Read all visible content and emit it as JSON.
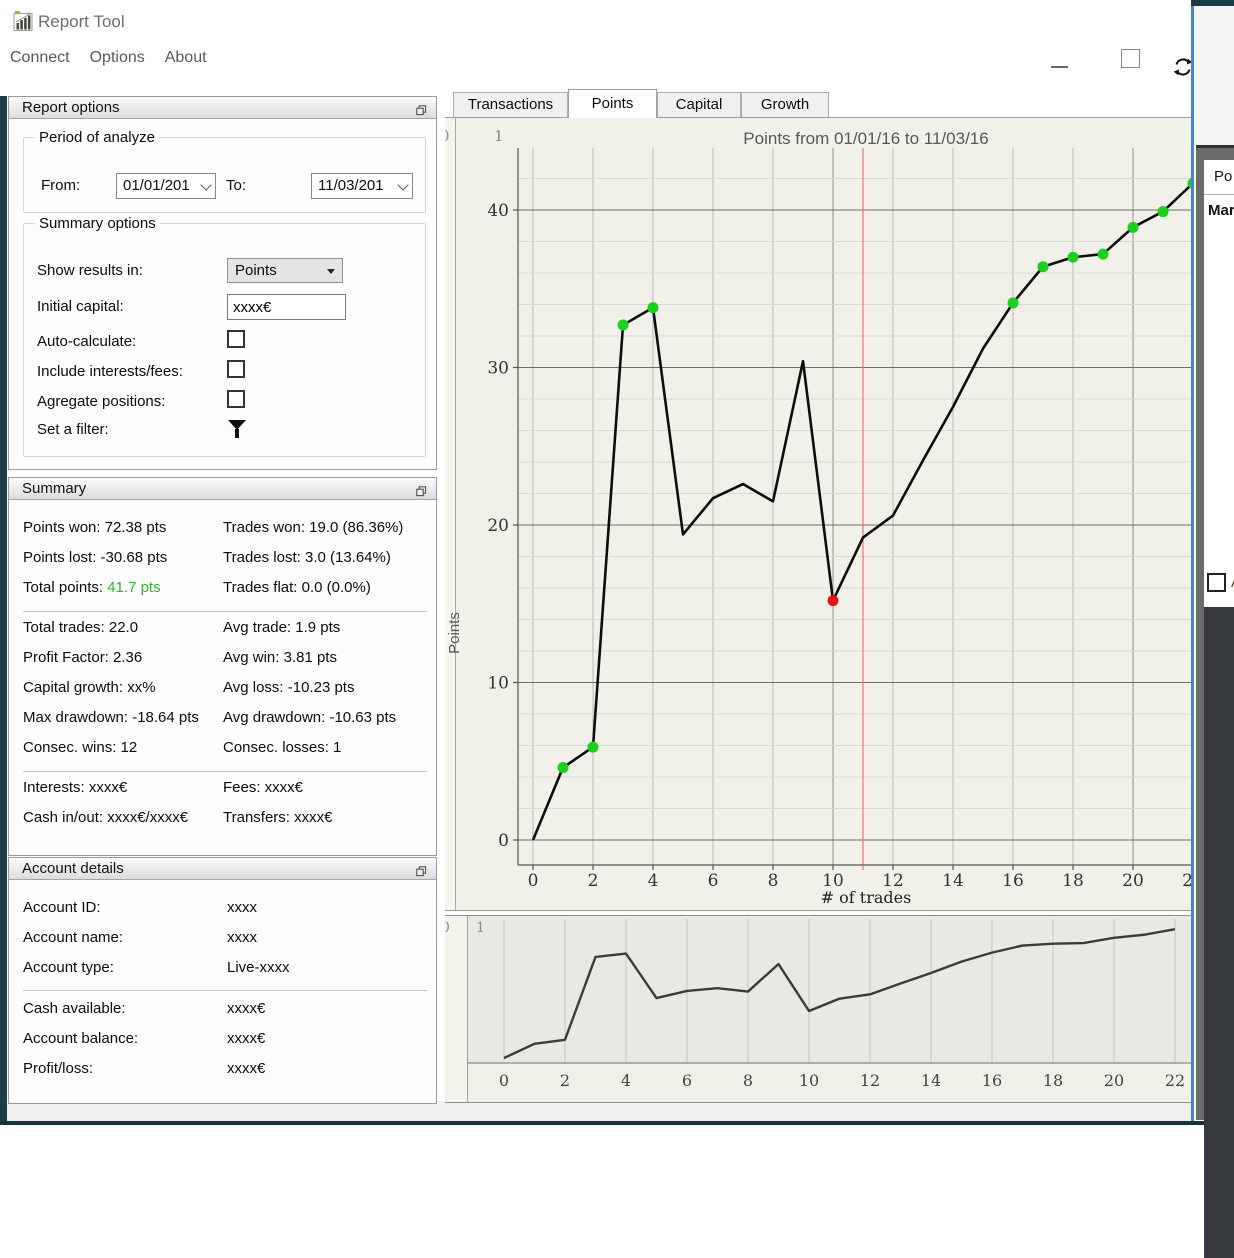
{
  "titlebar": {
    "title": "Report Tool",
    "menu": [
      "Connect",
      "Options",
      "About"
    ]
  },
  "panels": {
    "report_options": {
      "header": "Report options",
      "period_group": {
        "legend": "Period of analyze",
        "from_label": "From:",
        "from_value": "01/01/201",
        "to_label": "To:",
        "to_value": "11/03/201"
      },
      "summary_group": {
        "legend": "Summary options",
        "show_results_label": "Show results in:",
        "show_results_value": "Points",
        "initial_capital_label": "Initial capital:",
        "initial_capital_value": "xxxx€",
        "auto_calculate_label": "Auto-calculate:",
        "include_fees_label": "Include interests/fees:",
        "agregate_label": "Agregate positions:",
        "filter_label": "Set a filter:"
      }
    },
    "summary": {
      "header": "Summary",
      "green": "#2cb52c",
      "groups": [
        [
          [
            [
              {
                "t": "Points won: 72.38 pts"
              }
            ],
            [
              {
                "t": "Trades won: 19.0 (86.36%)"
              }
            ]
          ],
          [
            [
              {
                "t": "Points lost: -30.68 pts"
              }
            ],
            [
              {
                "t": "Trades lost: 3.0 (13.64%)"
              }
            ]
          ],
          [
            [
              {
                "t": "Total points: "
              },
              {
                "t": "41.7 pts",
                "c": "#2cb52c"
              }
            ],
            [
              {
                "t": "Trades flat: 0.0 (0.0%)"
              }
            ]
          ]
        ],
        [
          [
            [
              {
                "t": "Total trades: 22.0"
              }
            ],
            [
              {
                "t": "Avg trade: 1.9 pts"
              }
            ]
          ],
          [
            [
              {
                "t": "Profit Factor: 2.36"
              }
            ],
            [
              {
                "t": "Avg win: 3.81 pts"
              }
            ]
          ],
          [
            [
              {
                "t": "Capital growth: xx%"
              }
            ],
            [
              {
                "t": "Avg loss: -10.23 pts"
              }
            ]
          ],
          [
            [
              {
                "t": "Max drawdown: -18.64 pts"
              }
            ],
            [
              {
                "t": "Avg drawdown: -10.63 pts"
              }
            ]
          ],
          [
            [
              {
                "t": "Consec. wins: 12"
              }
            ],
            [
              {
                "t": "Consec. losses: 1"
              }
            ]
          ]
        ],
        [
          [
            [
              {
                "t": "Interests: xxxx€"
              }
            ],
            [
              {
                "t": "Fees: xxxx€"
              }
            ]
          ],
          [
            [
              {
                "t": "Cash in/out: xxxx€/xxxx€"
              }
            ],
            [
              {
                "t": "Transfers: xxxx€"
              }
            ]
          ]
        ]
      ]
    },
    "account_details": {
      "header": "Account details",
      "groups": [
        [
          {
            "label": "Account ID:",
            "value": "xxxx"
          },
          {
            "label": "Account name:",
            "value": "xxxx"
          },
          {
            "label": "Account type:",
            "value": "Live-xxxx"
          }
        ],
        [
          {
            "label": "Cash available:",
            "value": "xxxx€"
          },
          {
            "label": "Account balance:",
            "value": "xxxx€"
          },
          {
            "label": "Profit/loss:",
            "value": "xxxx€"
          }
        ]
      ]
    }
  },
  "tabs": {
    "items": [
      "Transactions",
      "Points",
      "Capital",
      "Growth"
    ],
    "active": "Points"
  },
  "chart_data": {
    "type": "line",
    "title": "Points from 01/01/16 to 11/03/16",
    "xlabel": "# of trades",
    "ylabel": "Points",
    "x": [
      0,
      1,
      2,
      3,
      4,
      5,
      6,
      7,
      8,
      9,
      10,
      11,
      12,
      13,
      14,
      15,
      16,
      17,
      18,
      19,
      20,
      21,
      22
    ],
    "values": [
      0,
      4.6,
      5.9,
      32.7,
      33.8,
      19.4,
      21.7,
      22.6,
      21.5,
      30.4,
      15.2,
      19.2,
      20.6,
      24.1,
      27.5,
      31.2,
      34.1,
      36.4,
      37.0,
      37.2,
      38.9,
      39.9,
      41.7
    ],
    "win_markers": [
      1,
      2,
      3,
      4,
      16,
      17,
      18,
      19,
      20,
      21,
      22
    ],
    "loss_markers": [
      10
    ],
    "vline_x": 11,
    "xlim": [
      0,
      22
    ],
    "ylim": [
      0,
      43
    ],
    "x_tick_step": 2,
    "y_major_step": 10,
    "y_minor_step": 2,
    "y_tick_labels": [
      "0",
      "10",
      "20",
      "30",
      "40"
    ],
    "clipped_scale_labels": [
      "0",
      "1"
    ],
    "colors": {
      "line": "#0d0d0d",
      "win": "#1bd11b",
      "loss": "#e81414",
      "vline": "#e87474",
      "grid_minor": "#d9d9d2",
      "grid_major": "#6e6e69",
      "grid_vert": "#b9b9b3",
      "overview_line": "#3b3b3b"
    },
    "legend": "off",
    "overview": {
      "type": "line",
      "note_same_series": true,
      "x_tick_labels": [
        "0",
        "2",
        "4",
        "6",
        "8",
        "10",
        "12",
        "14",
        "16",
        "18",
        "20",
        "22"
      ]
    }
  },
  "floating_window": {
    "header_partial": "Po",
    "row_partial": "Mar",
    "checkbox_label_partial": "A"
  }
}
